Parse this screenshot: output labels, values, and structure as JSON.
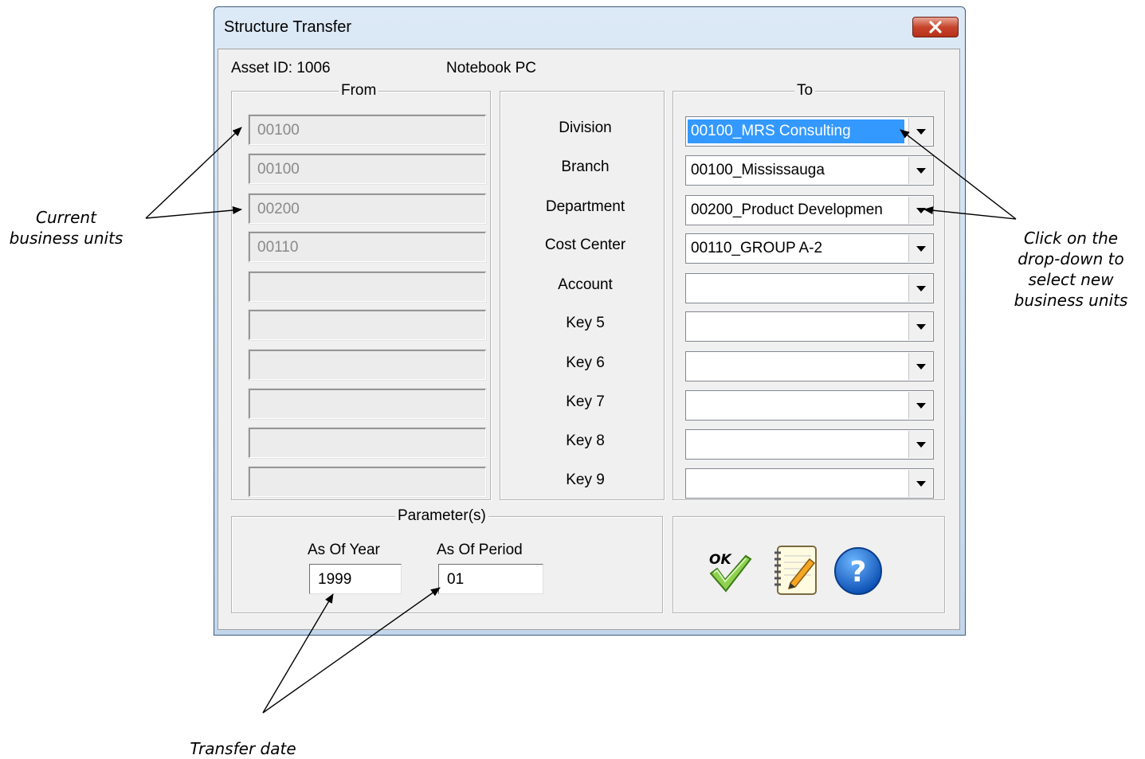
{
  "window": {
    "title": "Structure Transfer",
    "asset_id_label": "Asset ID: 1006",
    "asset_name": "Notebook PC"
  },
  "from_group": {
    "legend": "From",
    "values": [
      "00100",
      "00100",
      "00200",
      "00110",
      "",
      "",
      "",
      "",
      "",
      ""
    ]
  },
  "fields": {
    "labels": [
      "Division",
      "Branch",
      "Department",
      "Cost Center",
      "Account",
      "Key 5",
      "Key 6",
      "Key 7",
      "Key 8",
      "Key 9"
    ]
  },
  "to_group": {
    "legend": "To",
    "values": [
      "00100_MRS Consulting",
      "00100_Mississauga",
      "00200_Product Developmen",
      "00110_GROUP A-2",
      "",
      "",
      "",
      "",
      "",
      ""
    ]
  },
  "parameters": {
    "legend": "Parameter(s)",
    "year_label": "As Of Year",
    "year_value": "1999",
    "period_label": "As Of Period",
    "period_value": "01"
  },
  "buttons": {
    "ok_icon": "ok-check-icon",
    "notes_icon": "notepad-pencil-icon",
    "help_icon": "help-question-icon",
    "ok_text": "OK"
  },
  "annotations": {
    "current_units": [
      "Current",
      "business units"
    ],
    "dropdown_hint": [
      "Click on the",
      "drop-down to",
      "select new",
      "business units"
    ],
    "transfer_date": "Transfer date"
  },
  "colors": {
    "selection": "#3399ff",
    "close_button": "#c7452c",
    "window_frame": "#c3d7ec"
  }
}
